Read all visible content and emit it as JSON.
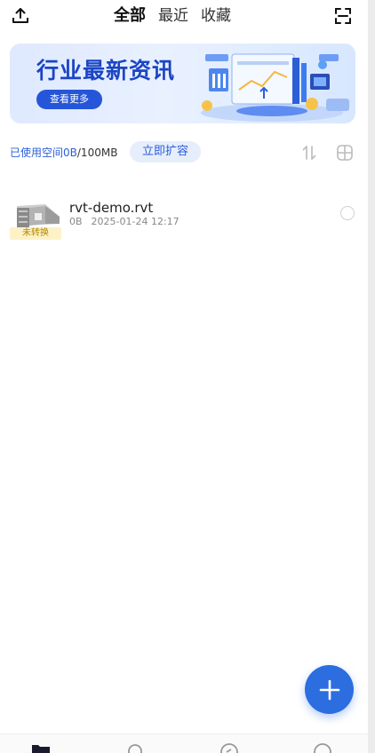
{
  "header": {
    "upload_icon": "upload-icon",
    "scan_icon": "scan-icon",
    "tabs": [
      {
        "label": "全部",
        "active": true
      },
      {
        "label": "最近",
        "active": false
      },
      {
        "label": "收藏",
        "active": false
      }
    ]
  },
  "banner": {
    "title": "行业最新资讯",
    "button_label": "查看更多"
  },
  "storage": {
    "used_prefix": "已使用空间",
    "used_value": "0B",
    "total": "/100MB",
    "expand_label": "立即扩容",
    "sort_icon": "sort-icon",
    "grid_icon": "grid-view-icon"
  },
  "files": [
    {
      "name": "rvt-demo.rvt",
      "size": "0B",
      "date": "2025-01-24 12:17",
      "status": "未转换"
    }
  ],
  "fab": {
    "icon": "plus-icon"
  },
  "bottom_nav": {
    "items": [
      {
        "icon": "files-icon",
        "active": true
      },
      {
        "icon": "bell-icon",
        "active": false
      },
      {
        "icon": "compass-icon",
        "active": false
      },
      {
        "icon": "profile-icon",
        "active": false
      }
    ]
  },
  "colors": {
    "accent": "#2c6ee0",
    "link": "#2b5fd9",
    "badge_bg": "#fdf1c7",
    "badge_text": "#b58800"
  }
}
